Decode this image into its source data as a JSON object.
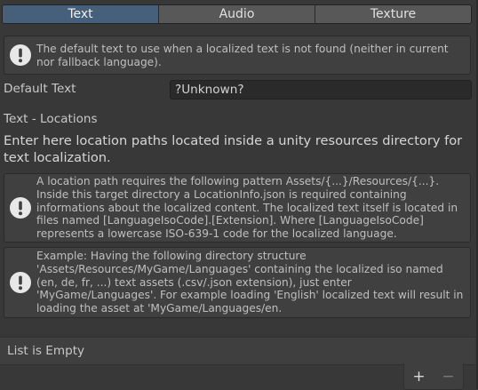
{
  "tabs": [
    {
      "label": "Text",
      "active": true
    },
    {
      "label": "Audio",
      "active": false
    },
    {
      "label": "Texture",
      "active": false
    }
  ],
  "help_default_text": "The default text to use when a localized text is not found (neither in current nor fallback language).",
  "default_text": {
    "label": "Default Text",
    "value": "?Unknown?"
  },
  "locations": {
    "title": "Text - Locations",
    "description": "Enter here location paths located inside a unity resources directory for text localization.",
    "help_pattern": "A location path requires the following pattern Assets/{...}/Resources/{...}. Inside this target directory a LocationInfo.json is required containing informations about the localized content. The localized text itself is located in files named [LanguageIsoCode].[Extension]. Where [LanguageIsoCode] represents a lowercase ISO-639-1 code for the localized language.",
    "help_example": "Example: Having the following directory structure 'Assets/Resources/MyGame/Languages' containing the localized iso named (en, de, fr, ...) text assets (.csv/.json extension), just enter 'MyGame/Languages'. For example loading 'English' localized text will result in loading the asset at 'MyGame/Languages/en."
  },
  "list": {
    "empty_label": "List is Empty",
    "add_label": "+",
    "remove_label": "−"
  },
  "colors": {
    "active_tab": "#46607c",
    "tab": "#585858",
    "background": "#383838"
  },
  "icons": {
    "info": "warning-exclamation-icon"
  }
}
